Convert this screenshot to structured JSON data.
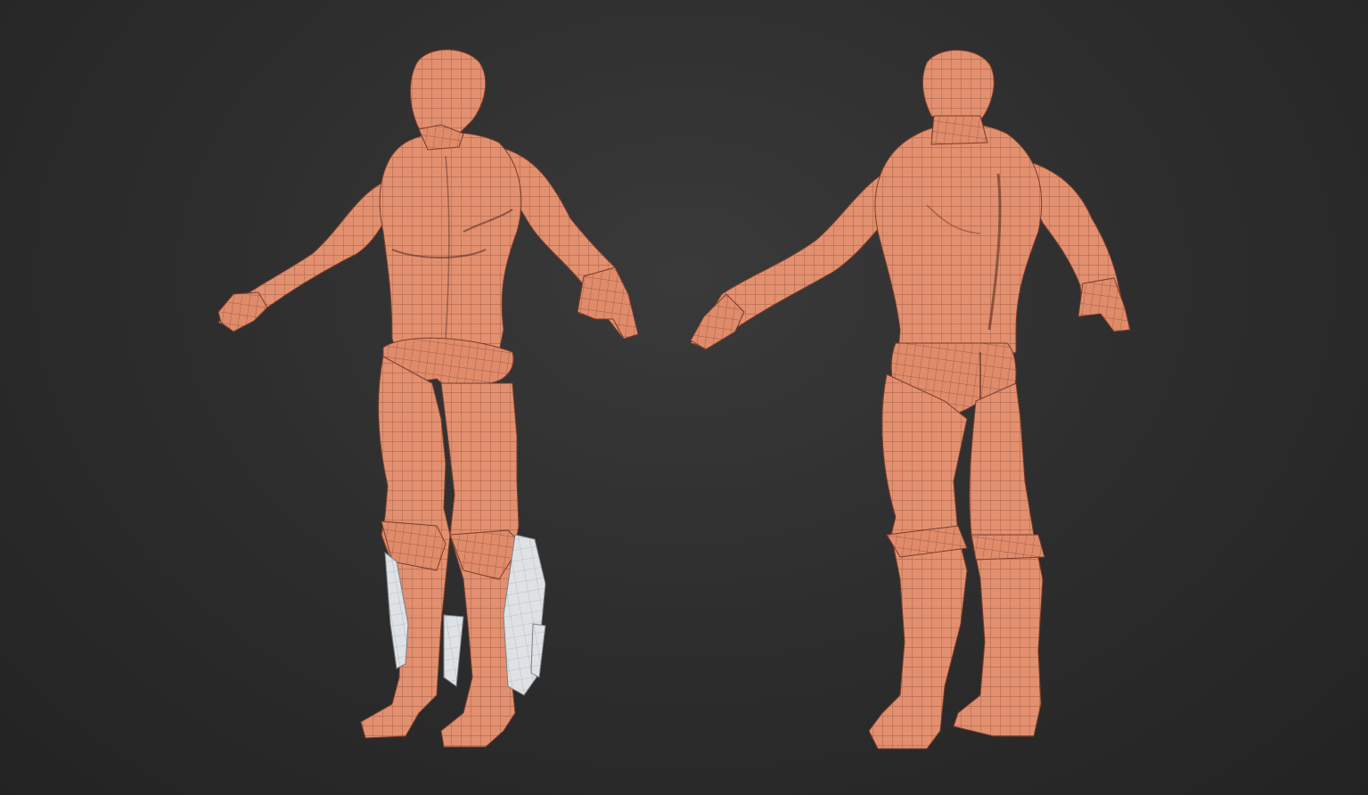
{
  "scene": {
    "background_color": "#2e2e2e",
    "skin_color": "#e2906f",
    "skin_shadow": "#b86a4e",
    "wire_color": "#5a2e22",
    "armor_color": "#d9dde0",
    "armor_shadow": "#a6acb2",
    "views": [
      {
        "view": "front-three-quarter",
        "has_leg_armor": true
      },
      {
        "view": "back-three-quarter",
        "has_leg_armor": false
      }
    ]
  }
}
